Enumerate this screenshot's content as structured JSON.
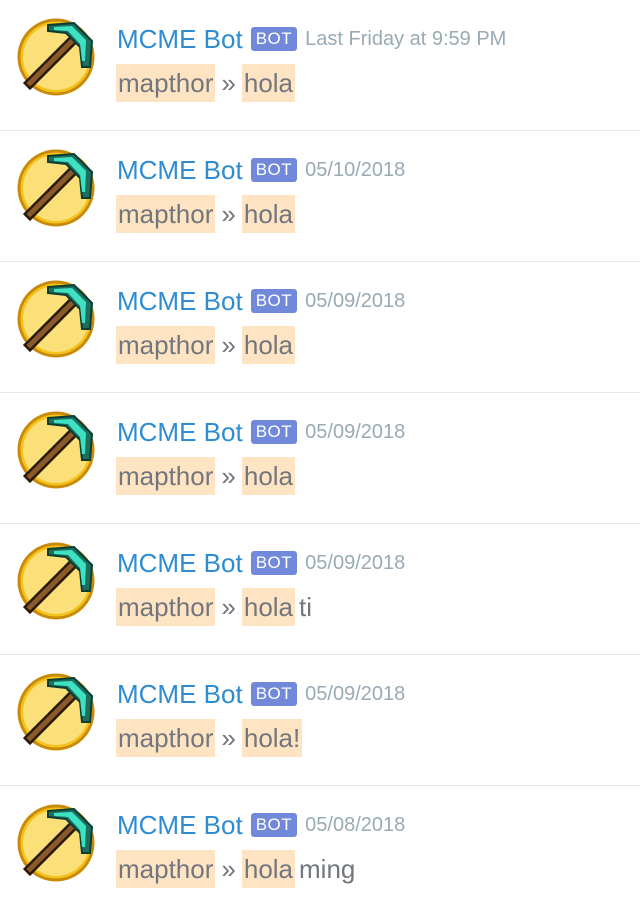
{
  "messages": [
    {
      "username": "MCME Bot",
      "tag": "BOT",
      "timestamp": "Last Friday at 9:59 PM",
      "sender": "mapthor",
      "separator": "»",
      "text": "hola",
      "extra": ""
    },
    {
      "username": "MCME Bot",
      "tag": "BOT",
      "timestamp": "05/10/2018",
      "sender": "mapthor",
      "separator": "»",
      "text": "hola",
      "extra": ""
    },
    {
      "username": "MCME Bot",
      "tag": "BOT",
      "timestamp": "05/09/2018",
      "sender": "mapthor",
      "separator": "»",
      "text": "hola",
      "extra": ""
    },
    {
      "username": "MCME Bot",
      "tag": "BOT",
      "timestamp": "05/09/2018",
      "sender": "mapthor",
      "separator": "»",
      "text": "hola",
      "extra": ""
    },
    {
      "username": "MCME Bot",
      "tag": "BOT",
      "timestamp": "05/09/2018",
      "sender": "mapthor",
      "separator": "»",
      "text": "hola",
      "extra": "ti"
    },
    {
      "username": "MCME Bot",
      "tag": "BOT",
      "timestamp": "05/09/2018",
      "sender": "mapthor",
      "separator": "»",
      "text": "hola!",
      "extra": ""
    },
    {
      "username": "MCME Bot",
      "tag": "BOT",
      "timestamp": "05/08/2018",
      "sender": "mapthor",
      "separator": "»",
      "text": "hola",
      "extra": "ming"
    }
  ],
  "colors": {
    "username": "#2f8cd0",
    "bot_tag": "#7289da",
    "highlight": "#ffe4c4",
    "timestamp": "#99aab5",
    "divider": "#e6e7e9"
  },
  "avatar_icon": "diamond-pickaxe-icon"
}
